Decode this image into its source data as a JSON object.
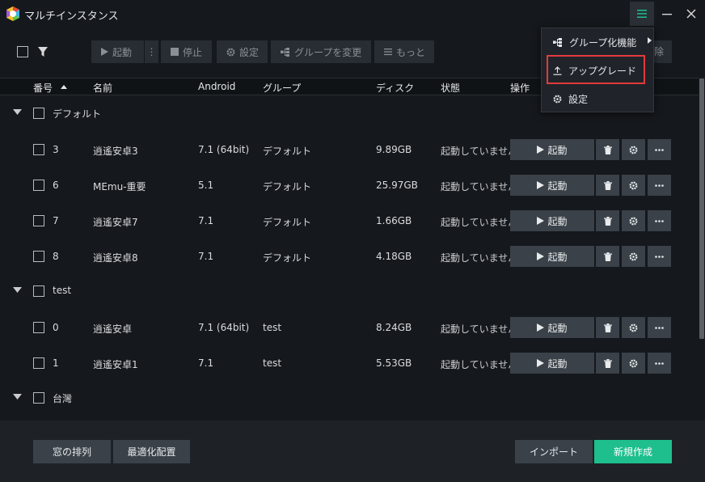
{
  "window": {
    "title": "マルチインスタンス"
  },
  "toolbar": {
    "start": "起動",
    "more_dots": "⋮",
    "stop": "停止",
    "settings": "設定",
    "change_group": "グループを変更",
    "more": "もっと",
    "delete_partial": "除"
  },
  "columns": {
    "number": "番号",
    "name": "名前",
    "android": "Android",
    "group": "グループ",
    "disk": "ディスク",
    "status": "状態",
    "actions": "操作"
  },
  "groups": [
    {
      "name": "デフォルト"
    },
    {
      "name": "test"
    },
    {
      "name": "台灣"
    }
  ],
  "instances": [
    {
      "num": "3",
      "name": "逍遙安卓3",
      "android": "7.1 (64bit)",
      "group": "デフォルト",
      "disk": "9.89GB",
      "status": "起動していません",
      "start": "起動"
    },
    {
      "num": "6",
      "name": "MEmu-重要",
      "android": "5.1",
      "group": "デフォルト",
      "disk": "25.97GB",
      "status": "起動していません",
      "start": "起動"
    },
    {
      "num": "7",
      "name": "逍遙安卓7",
      "android": "7.1",
      "group": "デフォルト",
      "disk": "1.66GB",
      "status": "起動していません",
      "start": "起動"
    },
    {
      "num": "8",
      "name": "逍遙安卓8",
      "android": "7.1",
      "group": "デフォルト",
      "disk": "4.18GB",
      "status": "起動していません",
      "start": "起動"
    },
    {
      "num": "0",
      "name": "逍遙安卓",
      "android": "7.1 (64bit)",
      "group": "test",
      "disk": "8.24GB",
      "status": "起動していません",
      "start": "起動"
    },
    {
      "num": "1",
      "name": "逍遙安卓1",
      "android": "7.1",
      "group": "test",
      "disk": "5.53GB",
      "status": "起動していません",
      "start": "起動"
    }
  ],
  "menu": {
    "group_features": "グループ化機能",
    "upgrade": "アップグレード",
    "settings": "設定"
  },
  "footer": {
    "arrange": "窓の排列",
    "optimize": "最適化配置",
    "import": "インポート",
    "new": "新規作成"
  },
  "colors": {
    "accent": "#1ebf8c",
    "highlight": "#e23b3b",
    "button": "#3a4148"
  }
}
